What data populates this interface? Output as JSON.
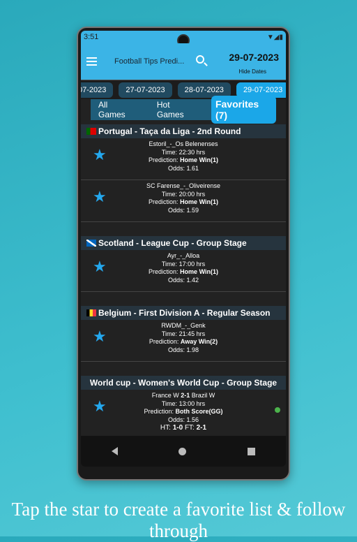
{
  "status": {
    "time": "3:51"
  },
  "appbar": {
    "title": "Football Tips Predi...",
    "date": "29-07-2023",
    "hide_dates": "Hide Dates"
  },
  "dates": [
    "07-2023",
    "27-07-2023",
    "28-07-2023",
    "29-07-2023"
  ],
  "tabs": [
    "All Games",
    "Hot Games",
    "Favorites (7)"
  ],
  "sections": [
    {
      "title": "Portugal - Taça da Liga - 2nd Round",
      "flag": "portugal",
      "matches": [
        {
          "teams": "Estoril_-_Os Belenenses",
          "time": "22:30 hrs",
          "prediction": "Home Win(1)",
          "odds": "1.61"
        },
        {
          "teams": "SC Farense_-_Oliveirense",
          "time": "20:00 hrs",
          "prediction": "Home Win(1)",
          "odds": "1.59"
        }
      ]
    },
    {
      "title": "Scotland - League Cup - Group Stage",
      "flag": "scotland",
      "matches": [
        {
          "teams": "Ayr_-_Alloa",
          "time": "17:00 hrs",
          "prediction": "Home Win(1)",
          "odds": "1.42"
        }
      ]
    },
    {
      "title": "Belgium - First Division A - Regular Season",
      "flag": "belgium",
      "matches": [
        {
          "teams": "RWDM_-_Genk",
          "time": "21:45 hrs",
          "prediction": "Away Win(2)",
          "odds": "1.98"
        }
      ]
    },
    {
      "title": "World cup - Women's World Cup - Group Stage",
      "flag": "",
      "matches": [
        {
          "home": "France W",
          "score": "2-1",
          "away": "Brazil W",
          "time": "13:00 hrs",
          "prediction": "Both Score(GG)",
          "odds": "1.56",
          "ht": "1-0",
          "ft": "2-1",
          "status_color": "#4cb34c"
        }
      ]
    }
  ],
  "labels": {
    "time": "Time:",
    "prediction": "Prediction:",
    "odds": "Odds:",
    "ht": "HT:",
    "ft": "FT:"
  },
  "caption": "Tap the star to create a favorite list & follow through",
  "colors": {
    "accent": "#1ba7e8",
    "appbar": "#3bb4e6",
    "star": "#24a8ee"
  }
}
